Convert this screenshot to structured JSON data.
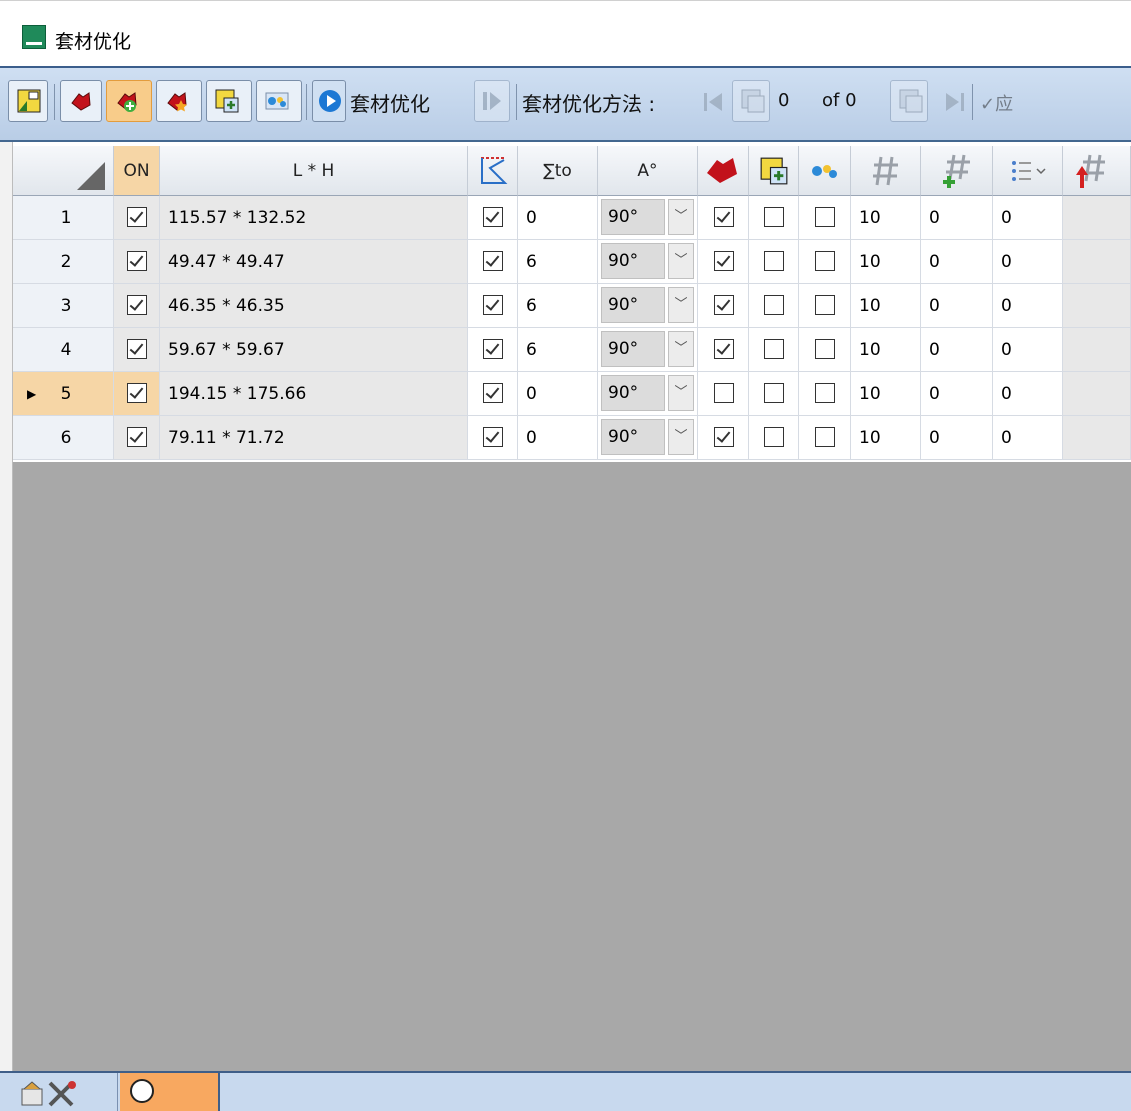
{
  "window": {
    "title": "套材优化"
  },
  "toolbar": {
    "run_label": "套材优化",
    "method_label": "套材优化方法 :",
    "page_current": "0",
    "page_of": "of 0",
    "apply_label": "✓应"
  },
  "grid": {
    "headers": {
      "on": "ON",
      "lh": "L * H",
      "sum_to": "∑to",
      "angle": "A°"
    },
    "rows": [
      {
        "num": "1",
        "on": true,
        "lh": "115.57 * 132.52",
        "contour": true,
        "sum_to": "0",
        "angle": "90°",
        "c1": true,
        "c2": false,
        "c3": false,
        "count": "10",
        "add": "0",
        "list": "0"
      },
      {
        "num": "2",
        "on": true,
        "lh": "49.47 * 49.47",
        "contour": true,
        "sum_to": "6",
        "angle": "90°",
        "c1": true,
        "c2": false,
        "c3": false,
        "count": "10",
        "add": "0",
        "list": "0"
      },
      {
        "num": "3",
        "on": true,
        "lh": "46.35 * 46.35",
        "contour": true,
        "sum_to": "6",
        "angle": "90°",
        "c1": true,
        "c2": false,
        "c3": false,
        "count": "10",
        "add": "0",
        "list": "0"
      },
      {
        "num": "4",
        "on": true,
        "lh": "59.67 * 59.67",
        "contour": true,
        "sum_to": "6",
        "angle": "90°",
        "c1": true,
        "c2": false,
        "c3": false,
        "count": "10",
        "add": "0",
        "list": "0"
      },
      {
        "num": "5",
        "on": true,
        "lh": "194.15 * 175.66",
        "contour": true,
        "sum_to": "0",
        "angle": "90°",
        "c1": false,
        "c2": false,
        "c3": false,
        "count": "10",
        "add": "0",
        "list": "0",
        "selected": true
      },
      {
        "num": "6",
        "on": true,
        "lh": "79.11 * 71.72",
        "contour": true,
        "sum_to": "0",
        "angle": "90°",
        "c1": true,
        "c2": false,
        "c3": false,
        "count": "10",
        "add": "0",
        "list": "0"
      }
    ]
  },
  "colors": {
    "accent": "#f6d6a6",
    "toolbar": "#c3d5ec",
    "empty_area": "#a8a8a8"
  },
  "bottom_tabs": [
    "settings-tools-icon",
    "circle-icon"
  ]
}
